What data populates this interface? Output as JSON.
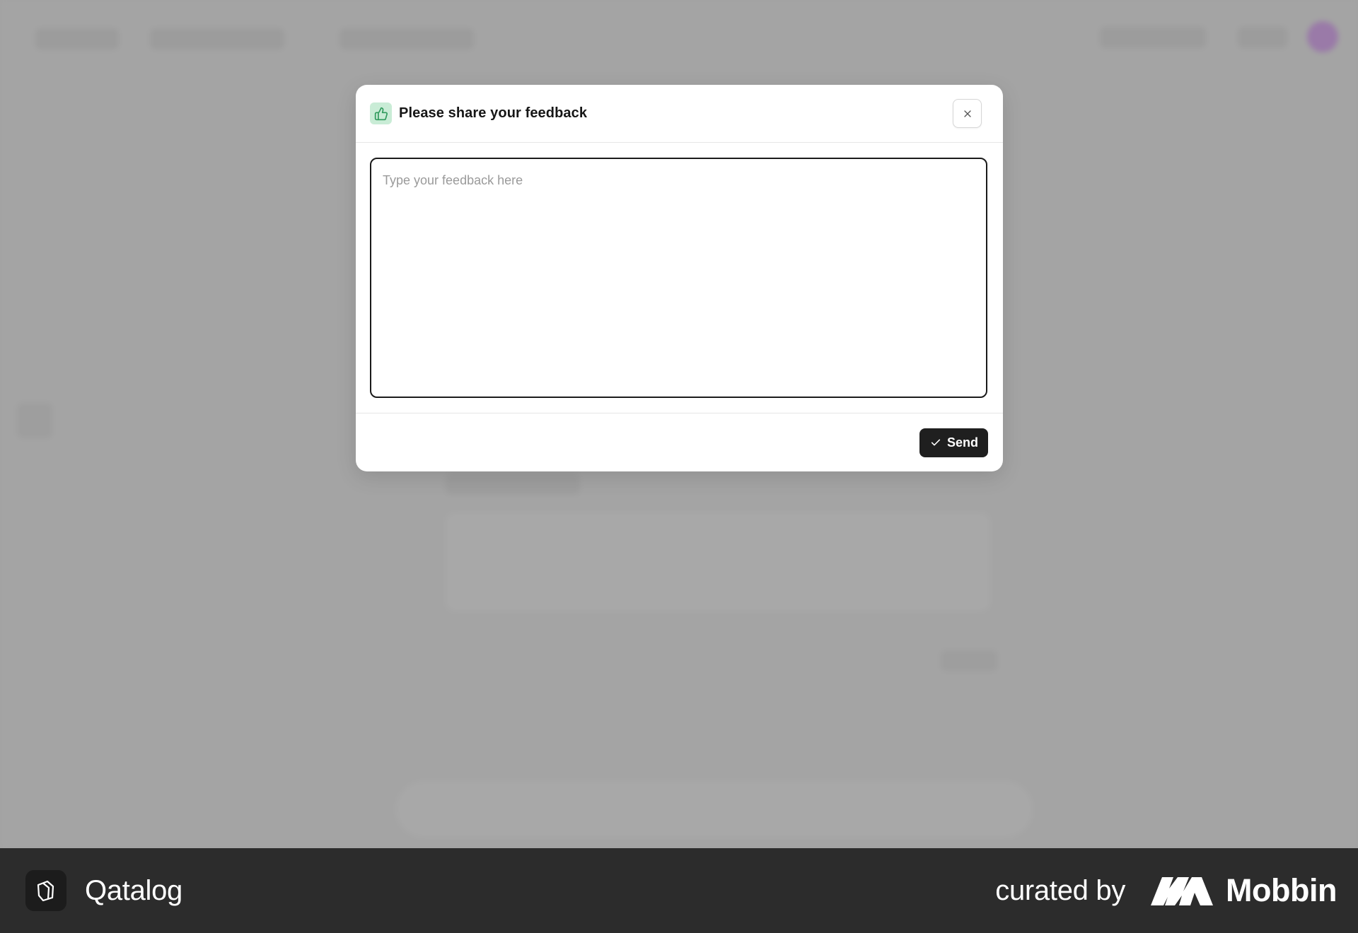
{
  "modal": {
    "title": "Please share your feedback",
    "header_icon": "thumbs-up-icon",
    "close_icon": "close-icon",
    "feedback_placeholder": "Type your feedback here",
    "feedback_value": "",
    "send_label": "Send",
    "send_icon": "check-icon"
  },
  "brand_bar": {
    "app_name": "Qatalog",
    "curated_label": "curated by",
    "curator_name": "Mobbin"
  },
  "colors": {
    "overlay": "#a3a3a3",
    "modal_bg": "#ffffff",
    "header_icon_bg": "#c9ecd6",
    "header_icon_fg": "#2f9a5c",
    "send_bg": "#1f1f1f",
    "brand_bar_bg": "#2c2c2c"
  }
}
